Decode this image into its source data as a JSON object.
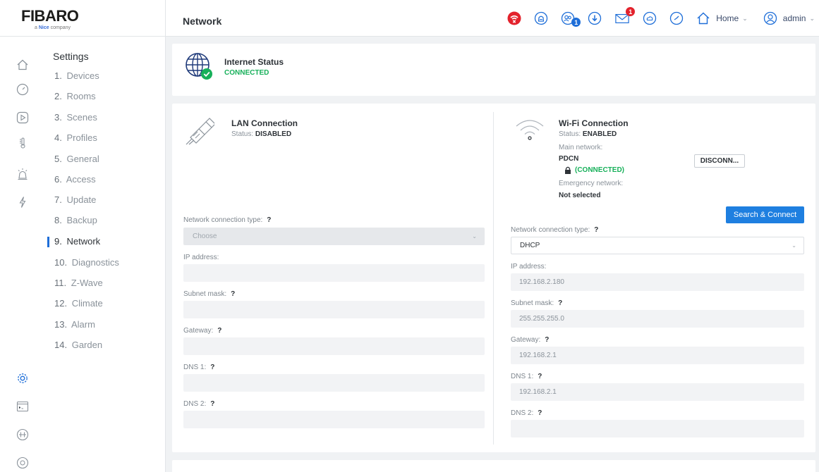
{
  "brand": {
    "name": "FIBARO",
    "sub_prefix": "a",
    "sub_brand": "Nice",
    "sub_suffix": "company"
  },
  "header": {
    "title": "Network",
    "home_label": "Home",
    "user_label": "admin",
    "icons": [
      "no-internet-icon",
      "alarm-icon",
      "users-icon",
      "download-icon",
      "mail-icon",
      "cloud-icon",
      "clock-icon",
      "home-icon",
      "user-icon"
    ],
    "users_badge": "1",
    "mail_badge": "1",
    "colors": {
      "alert": "#e3222c",
      "accent": "#1e6ed8",
      "ok": "#17b05a"
    }
  },
  "rail": {
    "icons": [
      "home-icon",
      "dashboard-icon",
      "scenes-icon",
      "temperature-icon",
      "alarm-icon",
      "energy-icon",
      "settings-icon",
      "terminal-icon",
      "plugins-icon",
      "help-icon"
    ]
  },
  "settings_menu": {
    "title": "Settings",
    "items": [
      {
        "num": "1.",
        "label": "Devices"
      },
      {
        "num": "2.",
        "label": "Rooms"
      },
      {
        "num": "3.",
        "label": "Scenes"
      },
      {
        "num": "4.",
        "label": "Profiles"
      },
      {
        "num": "5.",
        "label": "General"
      },
      {
        "num": "6.",
        "label": "Access"
      },
      {
        "num": "7.",
        "label": "Update"
      },
      {
        "num": "8.",
        "label": "Backup"
      },
      {
        "num": "9.",
        "label": "Network"
      },
      {
        "num": "10.",
        "label": "Diagnostics"
      },
      {
        "num": "11.",
        "label": "Z-Wave"
      },
      {
        "num": "12.",
        "label": "Climate"
      },
      {
        "num": "13.",
        "label": "Alarm"
      },
      {
        "num": "14.",
        "label": "Garden"
      }
    ],
    "active": "Network"
  },
  "internet": {
    "title": "Internet Status",
    "status": "CONNECTED"
  },
  "lan": {
    "title": "LAN Connection",
    "status_label": "Status:",
    "status_value": "DISABLED",
    "conn_type_label": "Network connection type:",
    "conn_type_value": "Choose",
    "ip_label": "IP address:",
    "subnet_label": "Subnet mask:",
    "gateway_label": "Gateway:",
    "dns1_label": "DNS 1:",
    "dns2_label": "DNS 2:",
    "help": "?"
  },
  "wifi": {
    "title": "Wi-Fi Connection",
    "status_label": "Status:",
    "status_value": "ENABLED",
    "main_network_label": "Main network:",
    "main_network": "PDCN",
    "main_network_state": "(CONNECTED)",
    "disconnect_button": "DISCONN...",
    "emergency_label": "Emergency network:",
    "emergency_value": "Not selected",
    "search_button": "Search & Connect",
    "conn_type_label": "Network connection type:",
    "conn_type_value": "DHCP",
    "ip_label": "IP address:",
    "ip_value": "192.168.2.180",
    "subnet_label": "Subnet mask:",
    "subnet_value": "255.255.255.0",
    "gateway_label": "Gateway:",
    "gateway_value": "192.168.2.1",
    "dns1_label": "DNS 1:",
    "dns1_value": "192.168.2.1",
    "dns2_label": "DNS 2:",
    "dns2_value": "",
    "help": "?"
  }
}
